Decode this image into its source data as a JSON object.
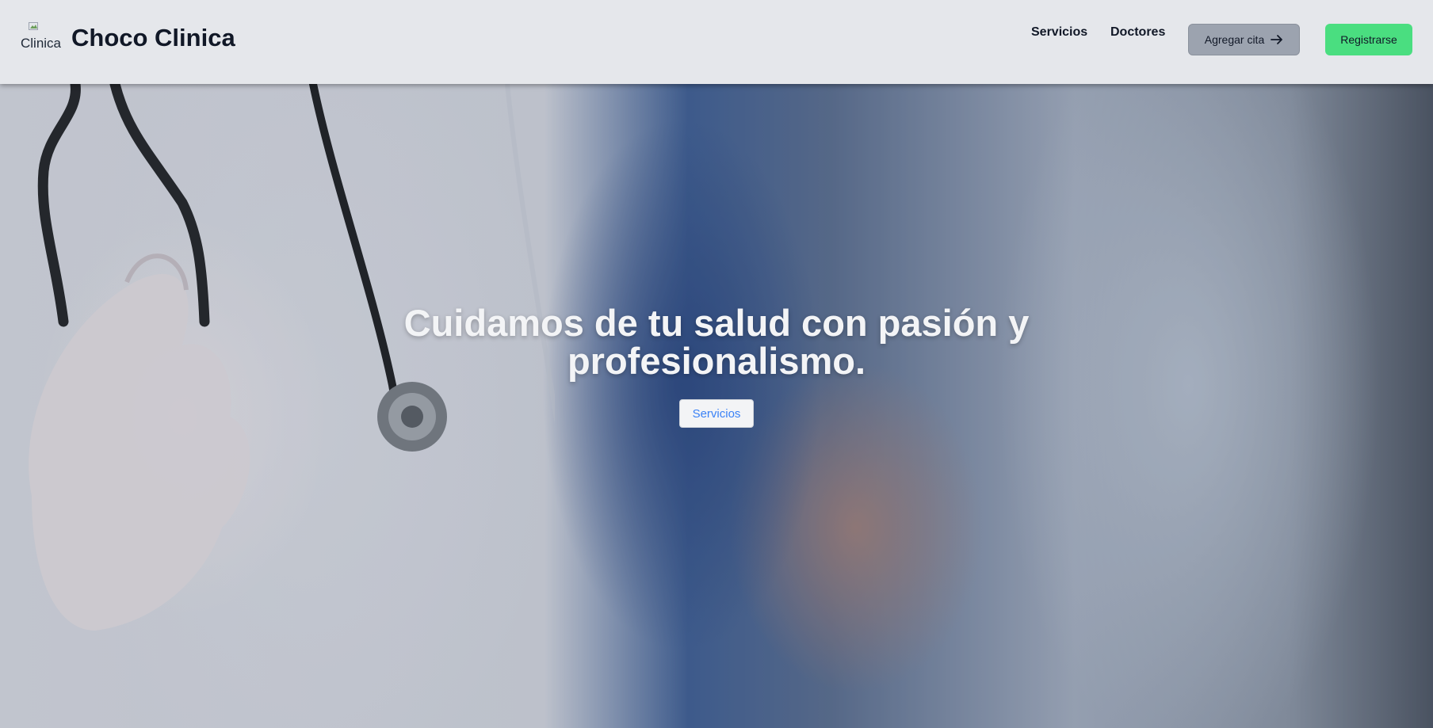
{
  "header": {
    "logo_alt": "Clinica",
    "brand": "Choco Clinica",
    "nav": {
      "servicios": "Servicios",
      "doctores": "Doctores"
    },
    "agregar_cita": "Agregar cita",
    "registrarse": "Registrarse"
  },
  "hero": {
    "title": "Cuidamos de tu salud con pasión y profesionalismo.",
    "button": "Servicios"
  },
  "colors": {
    "nav_bg": "#e5e7eb",
    "cita_button": "#9ca3af",
    "register_button": "#4ade80",
    "hero_button_text": "#3b82f6"
  },
  "icons": {
    "logo": "broken-image-icon",
    "arrow": "arrow-right-icon"
  }
}
